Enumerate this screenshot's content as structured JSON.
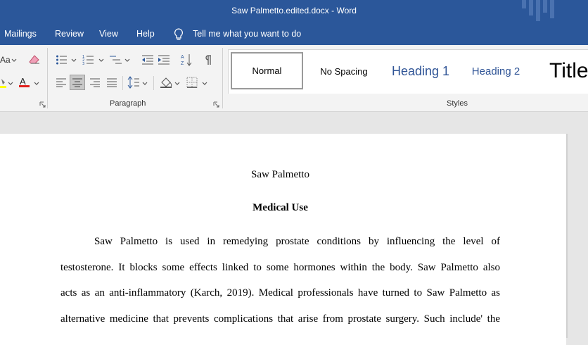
{
  "window": {
    "title": "Saw Palmetto.edited.docx  -  Word"
  },
  "menu": {
    "items": [
      "Mailings",
      "Review",
      "View",
      "Help"
    ],
    "tell_me": "Tell me what you want to do"
  },
  "ribbon": {
    "font_size_label": "Aa",
    "paragraph_label": "Paragraph",
    "styles_label": "Styles",
    "styles": [
      "Normal",
      "No Spacing",
      "Heading 1",
      "Heading 2",
      "Title"
    ],
    "colors": {
      "accent": "#2b579a",
      "heading": "#2f5496",
      "font_color_bar": "#e0201c",
      "highlight_bar": "#ffff00"
    }
  },
  "document": {
    "title": "Saw Palmetto",
    "heading": "Medical Use",
    "lines": [
      "Saw Palmetto is used in remedying prostate conditions by influencing the level of",
      "testosterone.   It blocks some effects linked to some hormones within the body. Saw Palmetto also",
      "acts as an anti-inflammatory (Karch, 2019). Medical professionals have turned to Saw Palmetto as",
      "alternative medicine that prevents complications that arise from prostate surgery. Such include' the"
    ]
  }
}
